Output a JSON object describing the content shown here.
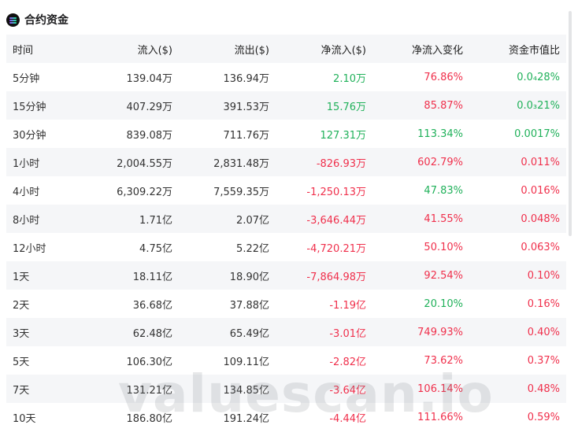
{
  "header": {
    "title": "合约资金",
    "logo_icon": "solana-icon"
  },
  "table": {
    "columns": [
      "时间",
      "流入($)",
      "流出($)",
      "净流入($)",
      "净流入变化",
      "资金市值比"
    ],
    "rows": [
      {
        "time": "5分钟",
        "inflow": "139.04万",
        "outflow": "136.94万",
        "net": "2.10万",
        "net_color": "pos",
        "change": "76.86%",
        "change_color": "neg",
        "ratio": "0.0₄28%",
        "ratio_color": "pos"
      },
      {
        "time": "15分钟",
        "inflow": "407.29万",
        "outflow": "391.53万",
        "net": "15.76万",
        "net_color": "pos",
        "change": "85.87%",
        "change_color": "neg",
        "ratio": "0.0₃21%",
        "ratio_color": "pos"
      },
      {
        "time": "30分钟",
        "inflow": "839.08万",
        "outflow": "711.76万",
        "net": "127.31万",
        "net_color": "pos",
        "change": "113.34%",
        "change_color": "pos",
        "ratio": "0.0017%",
        "ratio_color": "pos"
      },
      {
        "time": "1小时",
        "inflow": "2,004.55万",
        "outflow": "2,831.48万",
        "net": "-826.93万",
        "net_color": "neg",
        "change": "602.79%",
        "change_color": "neg",
        "ratio": "0.011%",
        "ratio_color": "neg"
      },
      {
        "time": "4小时",
        "inflow": "6,309.22万",
        "outflow": "7,559.35万",
        "net": "-1,250.13万",
        "net_color": "neg",
        "change": "47.83%",
        "change_color": "pos",
        "ratio": "0.016%",
        "ratio_color": "neg"
      },
      {
        "time": "8小时",
        "inflow": "1.71亿",
        "outflow": "2.07亿",
        "net": "-3,646.44万",
        "net_color": "neg",
        "change": "41.55%",
        "change_color": "neg",
        "ratio": "0.048%",
        "ratio_color": "neg"
      },
      {
        "time": "12小时",
        "inflow": "4.75亿",
        "outflow": "5.22亿",
        "net": "-4,720.21万",
        "net_color": "neg",
        "change": "50.10%",
        "change_color": "neg",
        "ratio": "0.063%",
        "ratio_color": "neg"
      },
      {
        "time": "1天",
        "inflow": "18.11亿",
        "outflow": "18.90亿",
        "net": "-7,864.98万",
        "net_color": "neg",
        "change": "92.54%",
        "change_color": "neg",
        "ratio": "0.10%",
        "ratio_color": "neg"
      },
      {
        "time": "2天",
        "inflow": "36.68亿",
        "outflow": "37.88亿",
        "net": "-1.19亿",
        "net_color": "neg",
        "change": "20.10%",
        "change_color": "pos",
        "ratio": "0.16%",
        "ratio_color": "neg"
      },
      {
        "time": "3天",
        "inflow": "62.48亿",
        "outflow": "65.49亿",
        "net": "-3.01亿",
        "net_color": "neg",
        "change": "749.93%",
        "change_color": "neg",
        "ratio": "0.40%",
        "ratio_color": "neg"
      },
      {
        "time": "5天",
        "inflow": "106.30亿",
        "outflow": "109.11亿",
        "net": "-2.82亿",
        "net_color": "neg",
        "change": "73.62%",
        "change_color": "neg",
        "ratio": "0.37%",
        "ratio_color": "neg"
      },
      {
        "time": "7天",
        "inflow": "131.21亿",
        "outflow": "134.85亿",
        "net": "-3.64亿",
        "net_color": "neg",
        "change": "106.14%",
        "change_color": "neg",
        "ratio": "0.48%",
        "ratio_color": "neg"
      },
      {
        "time": "10天",
        "inflow": "186.80亿",
        "outflow": "191.24亿",
        "net": "-4.44亿",
        "net_color": "neg",
        "change": "111.66%",
        "change_color": "neg",
        "ratio": "0.59%",
        "ratio_color": "neg"
      }
    ]
  },
  "watermark": "valuescan.io",
  "colors": {
    "positive": "#20b15a",
    "negative": "#f0304c",
    "row_alt": "#f5f6f8"
  }
}
